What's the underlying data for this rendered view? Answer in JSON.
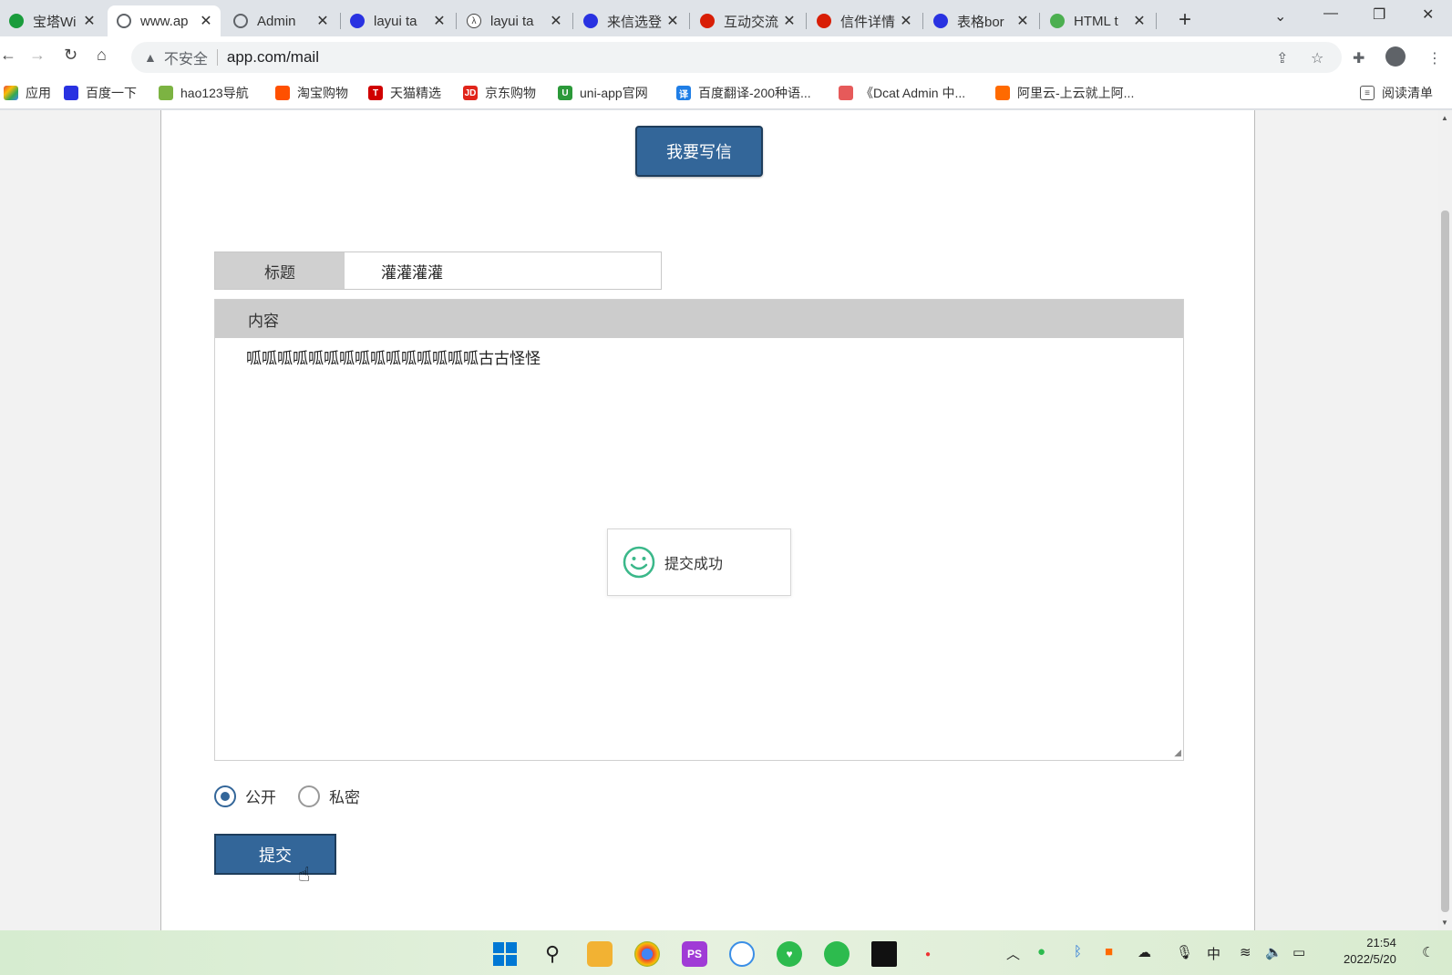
{
  "browser": {
    "tabs": [
      {
        "label": "宝塔Wi",
        "color": "#1a9c3c",
        "active": false
      },
      {
        "label": "www.ap",
        "color": "#5f6368",
        "active": true
      },
      {
        "label": "Admin",
        "color": "#5f6368",
        "active": false
      },
      {
        "label": "layui ta",
        "color": "#2932e1",
        "active": false
      },
      {
        "label": "layui ta",
        "color": "#444444",
        "active": false
      },
      {
        "label": "来信选登",
        "color": "#2932e1",
        "active": false
      },
      {
        "label": "互动交流",
        "color": "#d81e06",
        "active": false
      },
      {
        "label": "信件详情",
        "color": "#d81e06",
        "active": false
      },
      {
        "label": "表格bor",
        "color": "#2932e1",
        "active": false
      },
      {
        "label": "HTML t",
        "color": "#4caf50",
        "active": false
      }
    ],
    "security_label": "不安全",
    "url": "app.com/mail",
    "bookmarks": [
      {
        "label": "应用",
        "color": "#e8453c"
      },
      {
        "label": "百度一下",
        "color": "#2932e1"
      },
      {
        "label": "hao123导航",
        "color": "#7cb342"
      },
      {
        "label": "淘宝购物",
        "color": "#ff5000"
      },
      {
        "label": "天猫精选",
        "color": "#d00000"
      },
      {
        "label": "京东购物",
        "color": "#e1251b"
      },
      {
        "label": "uni-app官网",
        "color": "#2b9939"
      },
      {
        "label": "百度翻译-200种语...",
        "color": "#1f7ee6"
      },
      {
        "label": "《Dcat Admin 中...",
        "color": "#e65a5a"
      },
      {
        "label": "阿里云-上云就上阿...",
        "color": "#ff6a00"
      }
    ],
    "reading_list": "阅读清单"
  },
  "page": {
    "write_button": "我要写信",
    "title_label": "标题",
    "title_value": "灌灌灌灌",
    "content_label": "内容",
    "content_value": "呱呱呱呱呱呱呱呱呱呱呱呱呱呱呱古古怪怪",
    "toast_message": "提交成功",
    "radio_public": "公开",
    "radio_private": "私密",
    "submit_button": "提交"
  },
  "taskbar": {
    "time": "21:54",
    "date": "2022/5/20",
    "ime": "中"
  }
}
